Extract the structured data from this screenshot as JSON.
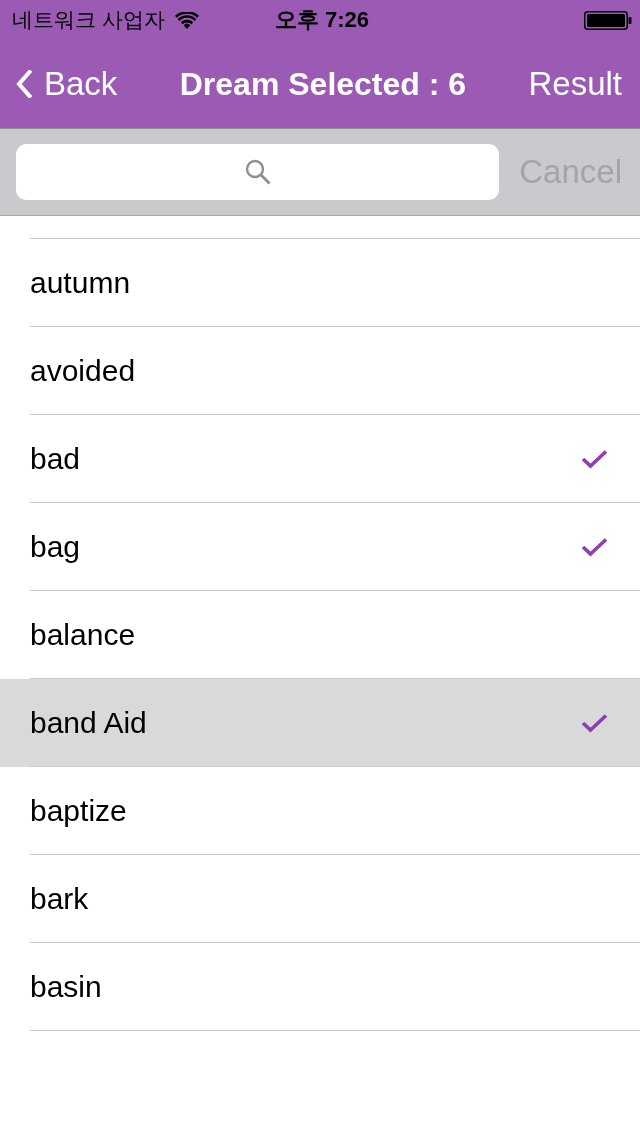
{
  "status_bar": {
    "carrier": "네트워크 사업자",
    "time": "오후 7:26"
  },
  "nav_bar": {
    "back": "Back",
    "title": "Dream Selected : 6",
    "action": "Result"
  },
  "search": {
    "cancel": {
      "label": "Cancel",
      "disabled": true
    }
  },
  "list": {
    "items": [
      {
        "label": "autumn",
        "checked": false,
        "selected": false
      },
      {
        "label": "avoided",
        "checked": false,
        "selected": false
      },
      {
        "label": "bad",
        "checked": true,
        "selected": false
      },
      {
        "label": "bag",
        "checked": true,
        "selected": false
      },
      {
        "label": "balance",
        "checked": false,
        "selected": false
      },
      {
        "label": "band Aid",
        "checked": true,
        "selected": true
      },
      {
        "label": "baptize",
        "checked": false,
        "selected": false
      },
      {
        "label": "bark",
        "checked": false,
        "selected": false
      },
      {
        "label": "basin",
        "checked": false,
        "selected": false
      }
    ]
  }
}
